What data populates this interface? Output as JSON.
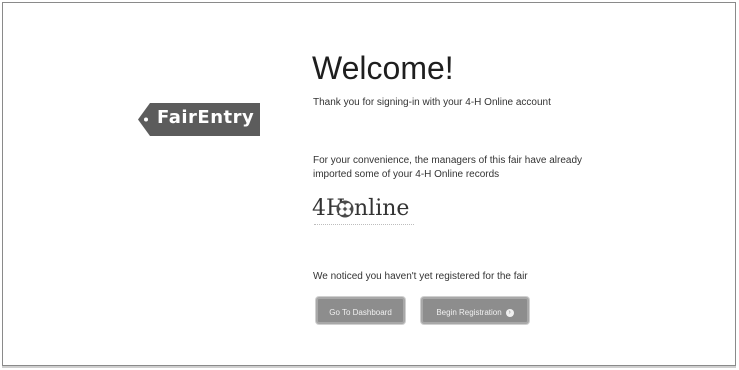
{
  "logo": {
    "text": "FairEntry"
  },
  "heading": "Welcome!",
  "thanks": "Thank you for signing-in with your 4-H Online account",
  "convenience": {
    "line1": "For your convenience, the managers of this fair have already",
    "line2": "imported some of your 4-H Online records"
  },
  "fourh_logo": {
    "prefix": "4H",
    "suffix": "nline"
  },
  "notice": "We noticed you haven't yet registered for the fair",
  "buttons": {
    "dashboard": "Go To Dashboard",
    "register": "Begin Registration"
  },
  "colors": {
    "logo_tag": "#5c5c5c",
    "button": "#8d8d8d"
  }
}
